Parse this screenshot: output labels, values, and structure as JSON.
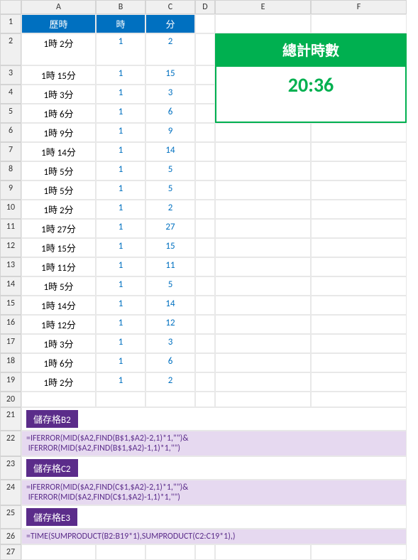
{
  "cols": [
    "A",
    "B",
    "C",
    "D",
    "E",
    "F"
  ],
  "headers": {
    "a": "歷時",
    "b": "時",
    "c": "分"
  },
  "rows": [
    {
      "a": "1時 2分",
      "b": "1",
      "c": "2"
    },
    {
      "a": "1時 15分",
      "b": "1",
      "c": "15"
    },
    {
      "a": "1時 3分",
      "b": "1",
      "c": "3"
    },
    {
      "a": "1時 6分",
      "b": "1",
      "c": "6"
    },
    {
      "a": "1時 9分",
      "b": "1",
      "c": "9"
    },
    {
      "a": "1時 14分",
      "b": "1",
      "c": "14"
    },
    {
      "a": "1時 5分",
      "b": "1",
      "c": "5"
    },
    {
      "a": "1時 5分",
      "b": "1",
      "c": "5"
    },
    {
      "a": "1時 2分",
      "b": "1",
      "c": "2"
    },
    {
      "a": "1時 27分",
      "b": "1",
      "c": "27"
    },
    {
      "a": "1時 15分",
      "b": "1",
      "c": "15"
    },
    {
      "a": "1時 11分",
      "b": "1",
      "c": "11"
    },
    {
      "a": "1時 5分",
      "b": "1",
      "c": "5"
    },
    {
      "a": "1時 14分",
      "b": "1",
      "c": "14"
    },
    {
      "a": "1時 12分",
      "b": "1",
      "c": "12"
    },
    {
      "a": "1時 3分",
      "b": "1",
      "c": "3"
    },
    {
      "a": "1時 6分",
      "b": "1",
      "c": "6"
    },
    {
      "a": "1時 2分",
      "b": "1",
      "c": "2"
    }
  ],
  "total": {
    "label": "總計時數",
    "value": "20:36"
  },
  "sections": [
    {
      "title": "儲存格B2",
      "formula": "=IFERROR(MID($A2,FIND(B$1,$A2)-2,1)*1,\"\")&\n IFERROR(MID($A2,FIND(B$1,$A2)-1,1)*1,\"\")"
    },
    {
      "title": "儲存格C2",
      "formula": "=IFERROR(MID($A2,FIND(C$1,$A2)-2,1)*1,\"\")&\n IFERROR(MID($A2,FIND(C$1,$A2)-1,1)*1,\"\")"
    },
    {
      "title": "儲存格E3",
      "formula": "=TIME(SUMPRODUCT(B2:B19*1),SUMPRODUCT(C2:C19*1),)"
    }
  ]
}
